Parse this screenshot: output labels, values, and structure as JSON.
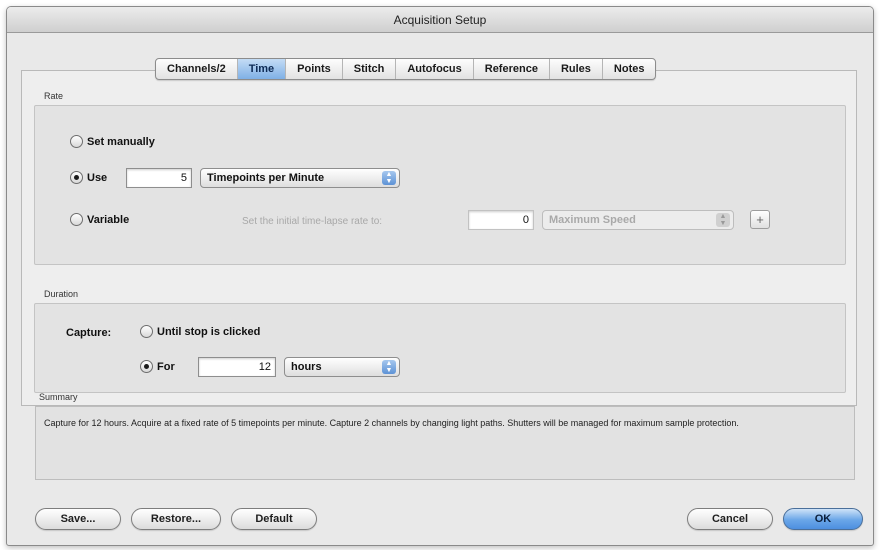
{
  "window": {
    "title": "Acquisition Setup"
  },
  "tabs": [
    {
      "label": "Channels/2",
      "selected": false
    },
    {
      "label": "Time",
      "selected": true
    },
    {
      "label": "Points",
      "selected": false
    },
    {
      "label": "Stitch",
      "selected": false
    },
    {
      "label": "Autofocus",
      "selected": false
    },
    {
      "label": "Reference",
      "selected": false
    },
    {
      "label": "Rules",
      "selected": false
    },
    {
      "label": "Notes",
      "selected": false
    }
  ],
  "rate": {
    "group_label": "Rate",
    "set_manually_label": "Set manually",
    "use_label": "Use",
    "use_value": "5",
    "use_unit": "Timepoints per Minute",
    "variable_label": "Variable",
    "variable_hint": "Set the initial time-lapse rate to:",
    "variable_value": "0",
    "variable_unit": "Maximum Speed",
    "plus_label": "+"
  },
  "duration": {
    "group_label": "Duration",
    "capture_label": "Capture:",
    "until_stop_label": "Until stop is clicked",
    "for_label": "For",
    "for_value": "12",
    "for_unit": "hours"
  },
  "summary": {
    "group_label": "Summary",
    "text": "Capture for 12 hours. Acquire at a fixed rate of 5 timepoints per minute. Capture 2 channels by changing light paths. Shutters will be managed for maximum sample protection."
  },
  "buttons": {
    "save": "Save...",
    "restore": "Restore...",
    "default": "Default",
    "cancel": "Cancel",
    "ok": "OK"
  },
  "colors": {
    "accent": "#6aa6e8",
    "window_bg": "#e9e9e9"
  }
}
